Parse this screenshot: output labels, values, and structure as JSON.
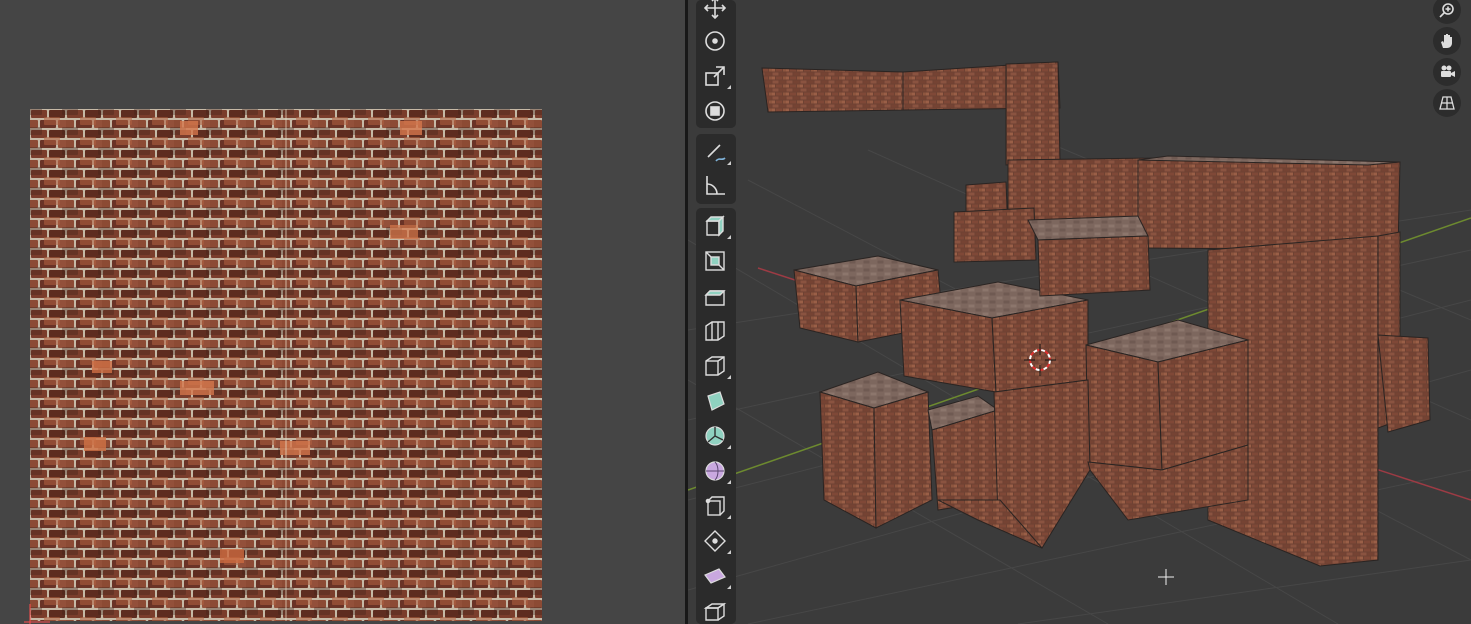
{
  "uv_editor": {
    "image": "brick-texture",
    "colors": {
      "background": "#454545",
      "mortar": "#c6b9a6",
      "brick": "#7a3d2c"
    }
  },
  "viewport": {
    "colors": {
      "background": "#3b3b3b",
      "x_axis": "#9c3b44",
      "y_axis": "#6d8a2f",
      "grid": "#474747"
    },
    "toolbar": {
      "tools": [
        {
          "id": "move",
          "icon": "move-icon"
        },
        {
          "id": "rotate",
          "icon": "rotate-icon"
        },
        {
          "id": "scale",
          "icon": "scale-icon"
        },
        {
          "id": "transform",
          "icon": "transform-icon"
        },
        {
          "id": "annotate",
          "icon": "annotate-icon"
        },
        {
          "id": "measure",
          "icon": "measure-icon"
        },
        {
          "id": "add-cube",
          "icon": "add-cube-icon"
        },
        {
          "id": "extrude-region",
          "icon": "extrude-region-icon"
        },
        {
          "id": "inset-faces",
          "icon": "inset-faces-icon"
        },
        {
          "id": "bevel",
          "icon": "bevel-icon"
        },
        {
          "id": "loop-cut",
          "icon": "loop-cut-icon"
        },
        {
          "id": "knife",
          "icon": "knife-icon"
        },
        {
          "id": "poly-build",
          "icon": "poly-build-icon"
        },
        {
          "id": "spin",
          "icon": "spin-icon"
        },
        {
          "id": "smooth",
          "icon": "smooth-icon"
        },
        {
          "id": "edge-slide",
          "icon": "edge-slide-icon"
        },
        {
          "id": "shrink-fatten",
          "icon": "shrink-fatten-icon"
        },
        {
          "id": "shear",
          "icon": "shear-icon"
        },
        {
          "id": "rip-region",
          "icon": "rip-region-icon"
        }
      ]
    },
    "navigation": [
      "zoom-icon",
      "hand-pan-icon",
      "camera-icon",
      "grid-perspective-icon"
    ],
    "cursor": "3d-cursor-icon"
  }
}
